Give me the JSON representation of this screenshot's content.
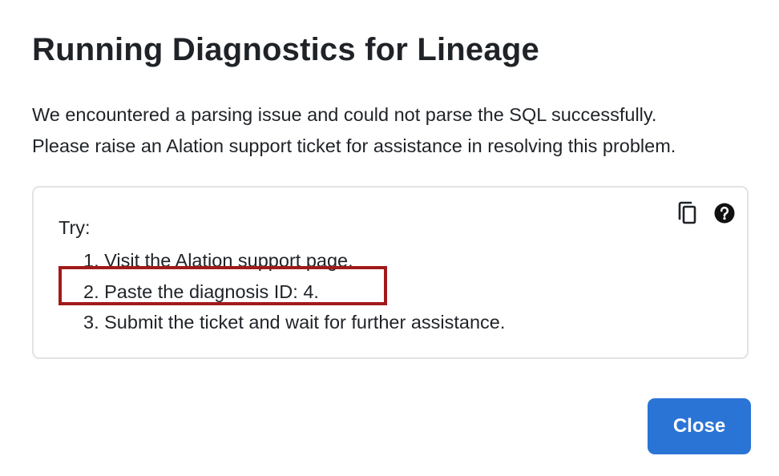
{
  "dialog": {
    "title": "Running Diagnostics for Lineage",
    "message_line1": "We encountered a parsing issue and could not parse the SQL successfully.",
    "message_line2": "Please raise an Alation support ticket for assistance in resolving this problem."
  },
  "try_box": {
    "label": "Try:",
    "steps": [
      "1. Visit the Alation support page.",
      "2. Paste the diagnosis ID: 4.",
      "3. Submit the ticket and wait for further assistance."
    ],
    "copy_icon": "copy-icon",
    "help_icon": "help-icon"
  },
  "footer": {
    "close_label": "Close"
  },
  "colors": {
    "primary_button": "#2a74d6",
    "highlight_border": "#a11a1a",
    "box_border": "#e1e3e6",
    "text": "#1f2328"
  }
}
